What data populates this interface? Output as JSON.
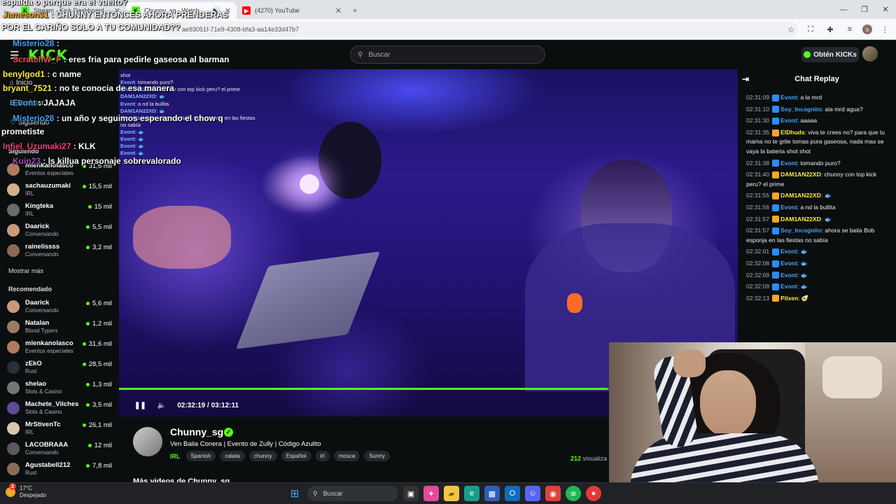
{
  "browser": {
    "tabs": [
      {
        "title": "Stream - Kick Dashboard",
        "favicon": "K"
      },
      {
        "title": "Chunny_sg - Watch the VOD",
        "favicon": "K"
      },
      {
        "title": "(4270) YouTube",
        "favicon": "▶"
      }
    ],
    "url": "ae93051f-71e9-4308-bfa3-aa14e33d47b7"
  },
  "kick": {
    "search_placeholder": "Buscar",
    "get_kicks_label": "Obtén KICKs"
  },
  "sidebar": {
    "nav": [
      "Inicio",
      "Explorar",
      "Siguiendo"
    ],
    "following_title": "Siguiendo",
    "following": [
      {
        "name": "mlenkanolasco",
        "category": "Eventos especiales",
        "viewers": "31,6 mil",
        "color": "#b07a60"
      },
      {
        "name": "sachauzumaki",
        "category": "IRL",
        "viewers": "15,5 mil",
        "color": "#d4b08a"
      },
      {
        "name": "Kingteka",
        "category": "IRL",
        "viewers": "15 mil",
        "color": "#6b6b6b"
      },
      {
        "name": "Daarick",
        "category": "Conversando",
        "viewers": "5,5 mil",
        "color": "#c99a7a"
      },
      {
        "name": "rainelissss",
        "category": "Conversando",
        "viewers": "3,2 mil",
        "color": "#8c6b52"
      }
    ],
    "show_more": "Mostrar más",
    "recommended_title": "Recomendado",
    "recommended": [
      {
        "name": "Daarick",
        "category": "Conversando",
        "viewers": "5,6 mil",
        "color": "#c99a7a"
      },
      {
        "name": "Natalan",
        "category": "Blood Typers",
        "viewers": "1,2 mil",
        "color": "#9a7b66"
      },
      {
        "name": "mlenkanolasco",
        "category": "Eventos especiales",
        "viewers": "31,6 mil",
        "color": "#b07a60"
      },
      {
        "name": "zEkO",
        "category": "Rust",
        "viewers": "28,5 mil",
        "color": "#2a2e3a"
      },
      {
        "name": "shelao",
        "category": "Slots & Casino",
        "viewers": "1,3 mil",
        "color": "#777777"
      },
      {
        "name": "Machete_Vilches",
        "category": "Slots & Casino",
        "viewers": "3,5 mil",
        "color": "#5c4a9a"
      },
      {
        "name": "MrStivenTc",
        "category": "IRL",
        "viewers": "26,1 mil",
        "color": "#d9c6b0"
      },
      {
        "name": "LACOBRAAA",
        "category": "Conversando",
        "viewers": "12 mil",
        "color": "#5a5a5a"
      },
      {
        "name": "Agustabell212",
        "category": "Rust",
        "viewers": "7,8 mil",
        "color": "#8a6d55"
      }
    ]
  },
  "stream_overlay": [
    {
      "user": "",
      "text": "espalda o porque era el vuelto?",
      "color": "#ffffff"
    },
    {
      "user": "Jameson31",
      "text": "CHUNNY ENTONCES AHORA PRENDERAS",
      "color": "#f5a623"
    },
    {
      "user": "",
      "text": "POR EL CARIÑO SOLO A TU COMUNIDAD??",
      "color": "#ffffff"
    },
    {
      "user": "Misterio28",
      "text": "",
      "color": "#42a5f5"
    },
    {
      "user": "ScratchW_F",
      "text": "eres fria para pedirle gaseosa al barman",
      "color": "#ef5350"
    },
    {
      "user": "benylgod1",
      "text": "c name",
      "color": "#ffeb3b"
    },
    {
      "user": "bryant_7521",
      "text": "no te conocia de esa manera",
      "color": "#ffeb3b"
    },
    {
      "user": "Evont",
      "text": "JAJAJA",
      "color": "#42a5f5"
    },
    {
      "user": "Misterio28",
      "text": "un año y seguimos esperando el chow q",
      "color": "#42a5f5"
    },
    {
      "user": "",
      "text": "prometiste",
      "color": "#ffffff"
    },
    {
      "user": "Infiel_Uzumaki27",
      "text": "KLK",
      "color": "#ec407a"
    },
    {
      "user": "Kuin23",
      "text": "ls killua personaje sobrevalorado",
      "color": "#ab47bc"
    }
  ],
  "video_overlay_chat": [
    {
      "user": "",
      "text": "shot"
    },
    {
      "user": "Evont",
      "text": "tomando puro?"
    },
    {
      "user": "DAM1AN22XD",
      "text": "chunny con top kick peru? el prime"
    },
    {
      "user": "DAM1AN22XD",
      "text": ""
    },
    {
      "user": "Evont",
      "text": "a nd la bullita"
    },
    {
      "user": "DAM1AN22XD",
      "text": ""
    },
    {
      "user": "Soy_Incognito",
      "text": "ahora se baila Bob esponja en las fiestas no sabía"
    },
    {
      "user": "Evont",
      "text": ""
    },
    {
      "user": "Evont",
      "text": ""
    },
    {
      "user": "Evont",
      "text": ""
    },
    {
      "user": "Evont",
      "text": ""
    }
  ],
  "player": {
    "time": "02:32:19 / 03:12:11",
    "progress": 0.7896
  },
  "stream": {
    "streamer": "Chunny_sg",
    "title": "Ven Baila Conera | Evento de Zully | Código Azulito",
    "category": "IRL",
    "tags": [
      "Spanish",
      "calata",
      "chunny",
      "Español",
      "irl",
      "mosca",
      "Sunny"
    ],
    "viewers_count": "212",
    "viewers_label": "visualiza",
    "more_videos": "Más videos de Chunny_sg"
  },
  "chat": {
    "title": "Chat Replay",
    "messages": [
      {
        "time": "02:31:09",
        "user": "Evont",
        "text": "a la mrd",
        "color": "#42a5f5"
      },
      {
        "time": "02:31:10",
        "user": "Soy_Incognito",
        "text": "ala mrd agua?",
        "color": "#42a5f5"
      },
      {
        "time": "02:31:30",
        "user": "Evont",
        "text": "aaaaa",
        "color": "#42a5f5"
      },
      {
        "time": "02:31:35",
        "user": "ElDhuds",
        "text": "viva te crees no? para que tu mama no te grite tomas pura gaseosa, nada mas se vaya la bateria shot shot",
        "color": "#ffeb3b"
      },
      {
        "time": "02:31:38",
        "user": "Evont",
        "text": "tomando puro?",
        "color": "#42a5f5"
      },
      {
        "time": "02:31:40",
        "user": "DAM1AN22XD",
        "text": "chunny con top kick peru? el prime",
        "color": "#ffeb3b"
      },
      {
        "time": "02:31:55",
        "user": "DAM1AN22XD",
        "text": "🐟",
        "color": "#ffeb3b"
      },
      {
        "time": "02:31:56",
        "user": "Evont",
        "text": "a nd la bullita",
        "color": "#42a5f5"
      },
      {
        "time": "02:31:57",
        "user": "DAM1AN22XD",
        "text": "🐟",
        "color": "#ffeb3b"
      },
      {
        "time": "02:31:57",
        "user": "Soy_Incognito",
        "text": "ahora se baila Bob esponja en las fiestas no sabía",
        "color": "#42a5f5"
      },
      {
        "time": "02:32:01",
        "user": "Evont",
        "text": "🐟",
        "color": "#42a5f5"
      },
      {
        "time": "02:32:08",
        "user": "Evont",
        "text": "🐟",
        "color": "#42a5f5"
      },
      {
        "time": "02:32:09",
        "user": "Evont",
        "text": "🐟",
        "color": "#42a5f5"
      },
      {
        "time": "02:32:09",
        "user": "Evont",
        "text": "🐟",
        "color": "#42a5f5"
      },
      {
        "time": "02:32:13",
        "user": "Pilxen",
        "text": "🥑",
        "color": "#ffeb3b"
      }
    ]
  },
  "taskbar": {
    "weather_temp": "17°C",
    "weather_desc": "Despejado",
    "search_placeholder": "Buscar",
    "notification_count": "2"
  },
  "colors": {
    "kick_green": "#53fc18",
    "background": "#0b0e0f"
  }
}
